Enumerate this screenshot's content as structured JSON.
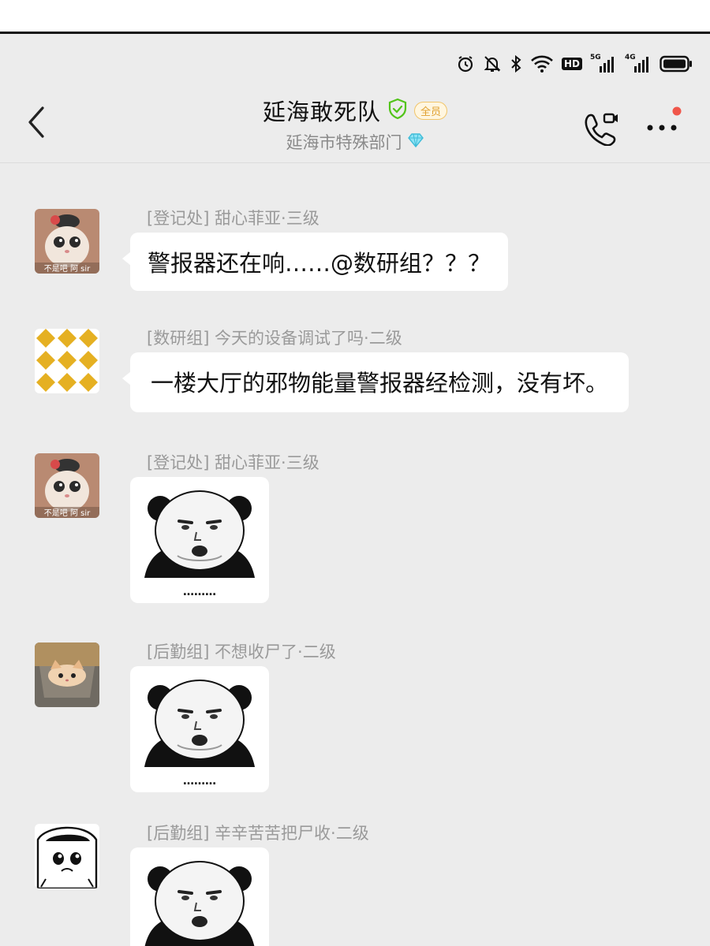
{
  "status_bar": {
    "icons": [
      "alarm-icon",
      "mute-bell-icon",
      "bluetooth-icon",
      "wifi-icon",
      "hd-icon",
      "signal-5g-icon",
      "signal-4g-icon",
      "battery-icon"
    ],
    "hd_label": "HD",
    "net1_label": "5G",
    "net2_label": "4G"
  },
  "header": {
    "title": "延海敢死队",
    "badge": "全员",
    "subtitle": "延海市特殊部门",
    "accent": "#52c41a",
    "notify_dot_color": "#f0564a"
  },
  "messages": [
    {
      "sender": "[登记处]  甜心菲亚·三级",
      "type": "text",
      "text": "警报器还在响……@数研组？？？",
      "avatar_caption": "不是吧 阿 sir"
    },
    {
      "sender": "[数研组]  今天的设备调试了吗·二级",
      "type": "text",
      "text": "一楼大厅的邪物能量警报器经检测，没有坏。"
    },
    {
      "sender": "[登记处]  甜心菲亚·三级",
      "type": "sticker",
      "caption": "………",
      "avatar_caption": "不是吧 阿 sir"
    },
    {
      "sender": "[后勤组]  不想收尸了·二级",
      "type": "sticker",
      "caption": "………"
    },
    {
      "sender": "[后勤组]  辛辛苦苦把尸收·二级",
      "type": "sticker",
      "caption": ""
    }
  ]
}
